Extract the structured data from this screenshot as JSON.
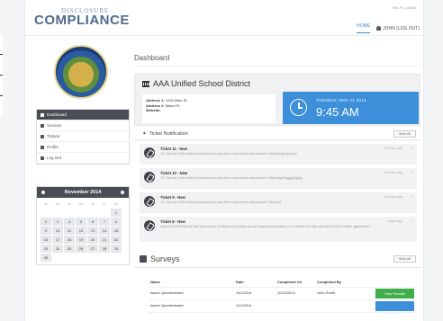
{
  "header": {
    "logo_small": "DISCLOSURE",
    "logo_main": "COMPLIANCE",
    "top_links": "HELP | LOGIN",
    "nav_home": "HOME",
    "nav_user": "JOHN (LOG OUT)"
  },
  "sidebar": {
    "items": [
      {
        "label": "Dashboard"
      },
      {
        "label": "Surveys"
      },
      {
        "label": "Tickets"
      },
      {
        "label": "Profile"
      },
      {
        "label": "Log Out"
      }
    ]
  },
  "calendar": {
    "month": "November 2014",
    "dow": [
      "Su",
      "Mo",
      "Tu",
      "We",
      "Th",
      "Fr",
      "Sa"
    ],
    "weeks": [
      [
        "",
        "",
        "",
        "",
        "",
        "",
        "1"
      ],
      [
        "2",
        "3",
        "4",
        "5",
        "6",
        "7",
        "8"
      ],
      [
        "9",
        "10",
        "11",
        "12",
        "13",
        "14",
        "15"
      ],
      [
        "16",
        "17",
        "18",
        "19",
        "20",
        "21",
        "22"
      ],
      [
        "23",
        "24",
        "25",
        "26",
        "27",
        "28",
        "29"
      ],
      [
        "30",
        "",
        "",
        "",
        "",
        "",
        ""
      ]
    ]
  },
  "main": {
    "title": "Dashboard",
    "school": {
      "name": "AAA Unified School District",
      "address1_label": "Address 1:",
      "address1": "1234 Main St",
      "address2_label": "Address 2:",
      "address2": "Miami FL",
      "website_label": "Website:"
    },
    "clock": {
      "date": "TUESDAY, NOV 11 2014",
      "time": "9:45 AM"
    },
    "tickets": {
      "title": "Ticket Notification",
      "view_all": "View All",
      "items": [
        {
          "title": "Ticket 11 - New",
          "text": "13. Has the [Client Name] experienced any other event-driven disclosures? webbyfsdytuyuyuye",
          "time": "17 hours ago"
        },
        {
          "title": "Ticket 10 - New",
          "text": "13. Has the [Client Name] experienced any other event-driven disclosures? dfsd fdfghfhgggjhjhjghg",
          "time": "18 hours ago"
        },
        {
          "title": "Ticket 9 - New",
          "text": "13. Has the [Client Name] experienced any other event-driven disclosures? sdfsdfsd",
          "time": "18 hours ago"
        },
        {
          "title": "Ticket 8 - New",
          "text": "Has the [Client Name] filed any notices of failures to provide annual financial information on or before the date specified in their written agreement?",
          "time": "4 days ago"
        }
      ]
    },
    "surveys": {
      "title": "Surveys",
      "view_all": "View All",
      "headers": [
        "Name",
        "Date",
        "Completed On",
        "Completed By"
      ],
      "rows": [
        {
          "name": "Issuer Questionnaire",
          "date": "11/1/2014",
          "completed_on": "11/10/2014",
          "completed_by": "John Smith",
          "action": "View Results"
        },
        {
          "name": "Issuer Questionnaire",
          "date": "11/1/2014",
          "completed_on": "",
          "completed_by": "",
          "action": ""
        }
      ]
    }
  },
  "colors": {
    "accent": "#3c8fd8",
    "success": "#3fae49",
    "sidebar_dark": "#4a4d55"
  }
}
